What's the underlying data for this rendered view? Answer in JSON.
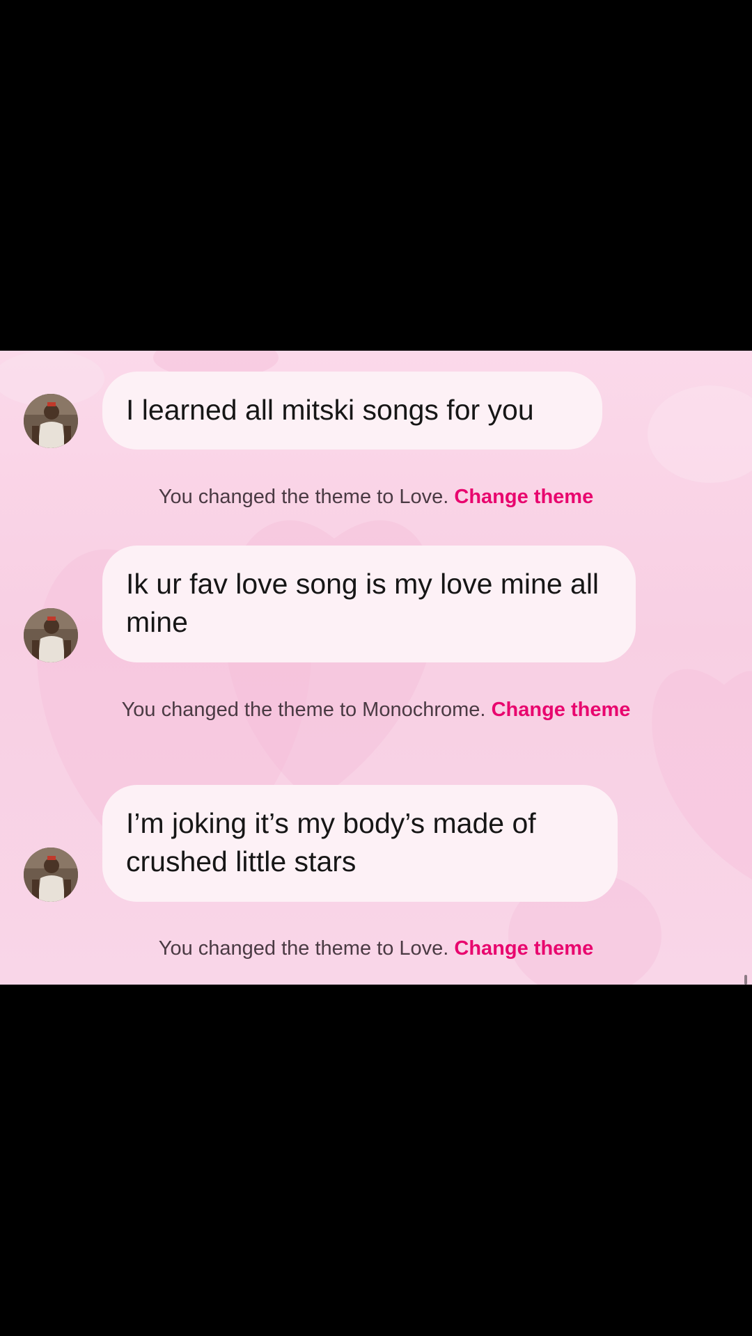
{
  "messages": [
    {
      "type": "received",
      "text": "I learned all mitski songs for you"
    },
    {
      "type": "notice",
      "prefix": "You changed the theme to Love.",
      "link": "Change theme"
    },
    {
      "type": "received",
      "text": "Ik ur fav love song is my love mine all mine"
    },
    {
      "type": "notice",
      "prefix": "You changed the theme to Monochrome.",
      "link": "Change theme"
    },
    {
      "type": "received",
      "text": "I’m joking it’s my body’s made of crushed little stars"
    },
    {
      "type": "notice",
      "prefix": "You changed the theme to Love.",
      "link": "Change theme"
    }
  ],
  "avatar_icon": "contact-avatar",
  "colors": {
    "background": "#f8cfe3",
    "bubble": "#fdf1f6",
    "link": "#e8066e",
    "notice_text": "#4a3a43"
  }
}
